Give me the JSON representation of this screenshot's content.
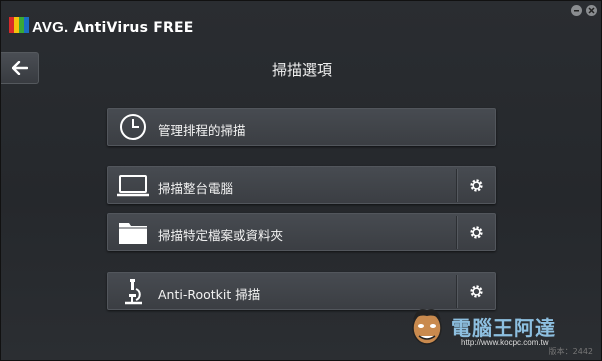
{
  "app": {
    "logo_text": "AVG.",
    "title": "AntiVirus FREE"
  },
  "window_controls": [
    "minimize",
    "close"
  ],
  "navigation": {
    "back_icon": "left-arrow-icon"
  },
  "page_title": "掃描選項",
  "scan_options": [
    {
      "label": "管理排程的掃描",
      "icon": "clock-icon",
      "has_settings": false
    },
    {
      "label": "掃描整台電腦",
      "icon": "laptop-icon",
      "has_settings": true
    },
    {
      "label": "掃描特定檔案或資料夾",
      "icon": "folder-icon",
      "has_settings": true
    },
    {
      "label": "Anti-Rootkit 掃描",
      "icon": "microscope-icon",
      "has_settings": true
    }
  ],
  "watermark": {
    "text": "電腦王阿達",
    "url": "http://www.kocpc.com.tw"
  },
  "version": "版本：2442",
  "colors": {
    "background": "#25282c",
    "button": "#43474c",
    "accent_red": "#d62a2a",
    "accent_yellow": "#f4c20d",
    "accent_green": "#3aa935",
    "accent_blue": "#1b6dc1"
  }
}
